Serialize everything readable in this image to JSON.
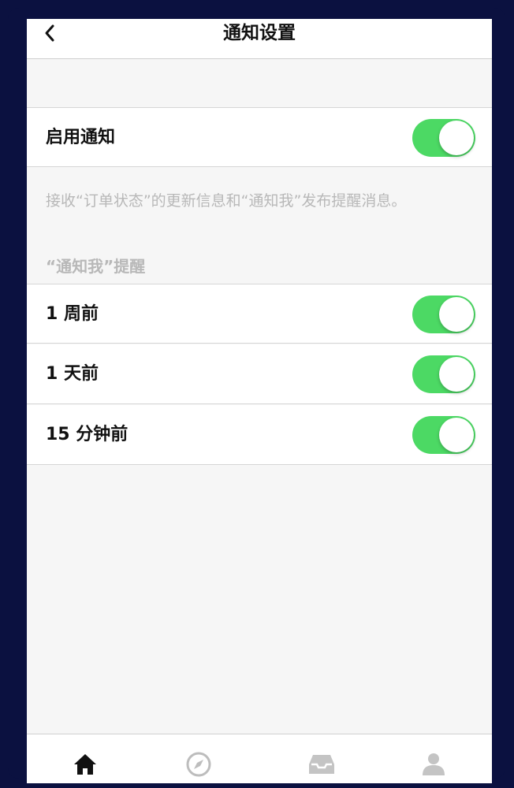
{
  "header": {
    "title": "通知设置"
  },
  "enable_row": {
    "label": "启用通知",
    "enabled": true
  },
  "note": "接收“订单状态”的更新信息和“通知我”发布提醒消息。",
  "reminders": {
    "section_title": "“通知我”提醒",
    "items": [
      {
        "label": "1 周前",
        "enabled": true
      },
      {
        "label": "1 天前",
        "enabled": true
      },
      {
        "label": "15 分钟前",
        "enabled": true
      }
    ]
  },
  "colors": {
    "toggle_on": "#4cd964",
    "frame": "#0b1140"
  },
  "tabbar": {
    "tabs": [
      {
        "icon": "home-icon",
        "active": true
      },
      {
        "icon": "compass-icon",
        "active": false
      },
      {
        "icon": "inbox-icon",
        "active": false
      },
      {
        "icon": "user-icon",
        "active": false
      }
    ]
  }
}
